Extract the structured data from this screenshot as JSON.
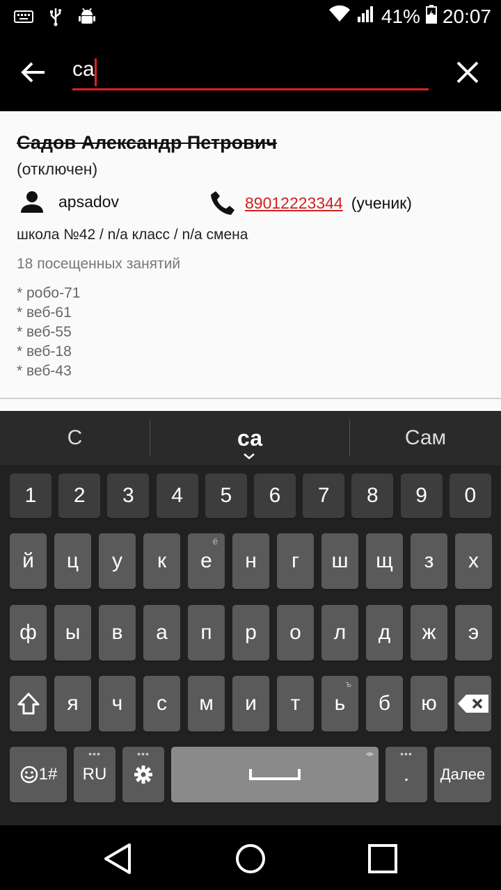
{
  "status_bar": {
    "battery": "41%",
    "time": "20:07",
    "icons": [
      "keyboard-icon",
      "usb-icon",
      "android-debug-icon",
      "wifi-icon",
      "signal-icon",
      "battery-icon"
    ]
  },
  "search": {
    "query": "са",
    "icons": {
      "back": "arrow-back-icon",
      "clear": "close-icon"
    }
  },
  "result": {
    "name": "Садов Александр Петрович",
    "status": "(отключен)",
    "login": "apsadov",
    "phone": "89012223344",
    "phone_role": "(ученик)",
    "school": "школа №42 / n/a класс / n/a смена",
    "visits": "18 посещенных занятий",
    "groups": [
      "* робо-71",
      "* веб-61",
      "* веб-55",
      "* веб-18",
      "* веб-43"
    ]
  },
  "keyboard": {
    "suggestions": [
      "С",
      "са",
      "Сам"
    ],
    "digits": [
      "1",
      "2",
      "3",
      "4",
      "5",
      "6",
      "7",
      "8",
      "9",
      "0"
    ],
    "row1": [
      "й",
      "ц",
      "у",
      "к",
      "е",
      "н",
      "г",
      "ш",
      "щ",
      "з",
      "х"
    ],
    "row1_hints": {
      "е": "ё"
    },
    "row2": [
      "ф",
      "ы",
      "в",
      "а",
      "п",
      "р",
      "о",
      "л",
      "д",
      "ж",
      "э"
    ],
    "row3": [
      "я",
      "ч",
      "с",
      "м",
      "и",
      "т",
      "ь",
      "б",
      "ю"
    ],
    "row3_hints": {
      "ь": "ъ"
    },
    "symbols_label": "1#",
    "lang_label": "RU",
    "period_label": ".",
    "enter_label": "Далее"
  },
  "colors": {
    "accent": "#e52020",
    "link": "#d32020",
    "keyboard_bg": "#212121",
    "key_bg": "#5a5a5a"
  }
}
